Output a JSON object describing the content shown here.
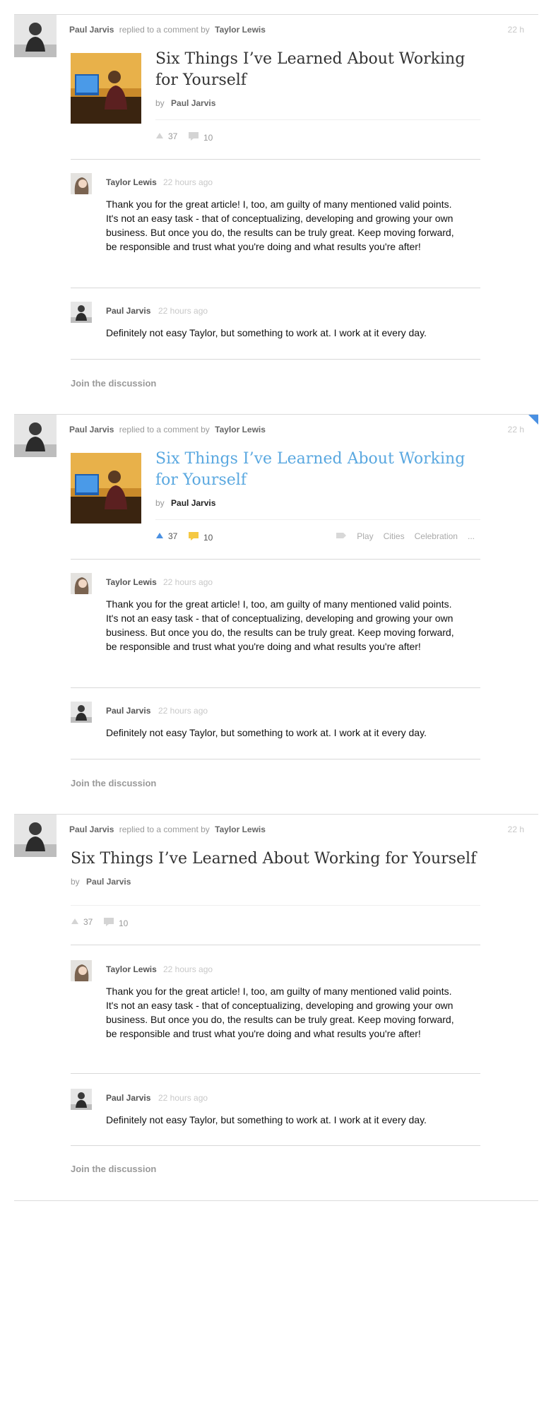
{
  "feed": [
    {
      "actor": "Paul Jarvis",
      "verb": "replied to a comment by",
      "target": "Taylor Lewis",
      "time": "22 h",
      "article": {
        "title": "Six Things I’ve Learned About Working for Yourself",
        "by_label": "by",
        "author": "Paul Jarvis",
        "upvotes": "37",
        "comments": "10"
      },
      "comments": [
        {
          "author": "Taylor Lewis",
          "time": "22 hours ago",
          "body": "Thank you for the great article! I, too, am guilty of many mentioned valid points. It's not an easy task - that of conceptualizing, developing and growing your own business. But once you do, the results can be truly great. Keep moving forward, be responsible and trust what you're doing and what results you're after!"
        },
        {
          "author": "Paul Jarvis",
          "time": "22 hours ago",
          "body": "Definitely not easy Taylor, but something to work at. I work at it every day."
        }
      ],
      "join_label": "Join the discussion"
    },
    {
      "actor": "Paul Jarvis",
      "verb": "replied to a comment by",
      "target": "Taylor Lewis",
      "time": "22 h",
      "article": {
        "title": "Six Things I’ve Learned About Working for Yourself",
        "by_label": "by",
        "author": "Paul Jarvis",
        "upvotes": "37",
        "comments": "10",
        "tags": [
          "Play",
          "Cities",
          "Celebration",
          "..."
        ]
      },
      "comments": [
        {
          "author": "Taylor Lewis",
          "time": "22 hours ago",
          "body": "Thank you for the great article! I, too, am guilty of many mentioned valid points. It's not an easy task - that of conceptualizing, developing and growing your own business. But once you do, the results can be truly great. Keep moving forward, be responsible and trust what you're doing and what results you're after!"
        },
        {
          "author": "Paul Jarvis",
          "time": "22 hours ago",
          "body": "Definitely not easy Taylor, but something to work at. I work at it every day."
        }
      ],
      "join_label": "Join the discussion"
    },
    {
      "actor": "Paul Jarvis",
      "verb": "replied to a comment by",
      "target": "Taylor Lewis",
      "time": "22 h",
      "article": {
        "title": "Six Things I’ve Learned About Working for Yourself",
        "by_label": "by",
        "author": "Paul Jarvis",
        "upvotes": "37",
        "comments": "10"
      },
      "comments": [
        {
          "author": "Taylor Lewis",
          "time": "22 hours ago",
          "body": "Thank you for the great article! I, too, am guilty of many mentioned valid points. It's not an easy task - that of conceptualizing, developing and growing your own business. But once you do, the results can be truly great. Keep moving forward, be responsible and trust what you're doing and what results you're after!"
        },
        {
          "author": "Paul Jarvis",
          "time": "22 hours ago",
          "body": "Definitely not easy Taylor, but something to work at. I work at it every day."
        }
      ],
      "join_label": "Join the discussion"
    }
  ],
  "colors": {
    "accent": "#5aa8e0",
    "accent_strong": "#4a90e2",
    "comment_icon_active": "#f5c842",
    "muted": "#999999"
  },
  "icons": {
    "upvote": "triangle-up-icon",
    "comment": "speech-bubble-icon",
    "tag": "tag-icon"
  }
}
